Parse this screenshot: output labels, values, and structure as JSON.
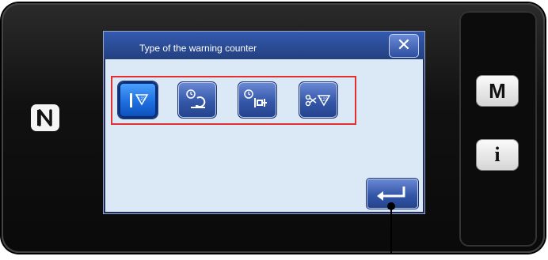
{
  "dialog": {
    "title": "Type of the warning counter",
    "close_icon": "close-icon",
    "counter_types": [
      {
        "icon": "bobbin-thread-counter-icon",
        "selected": true
      },
      {
        "icon": "operating-time-counter-icon",
        "selected": false
      },
      {
        "icon": "power-on-time-counter-icon",
        "selected": false
      },
      {
        "icon": "thread-trimming-counter-icon",
        "selected": false
      }
    ],
    "enter_icon": "enter-icon"
  },
  "side_panel": {
    "mode_label": "M",
    "info_label": "i",
    "nfc_icon": "nfc-icon"
  },
  "colors": {
    "title_bar": "#2b4a95",
    "dialog_body": "#dbe8f5",
    "selected_button": "#1f6fe0",
    "button": "#3557a8",
    "highlight_frame": "#e03030"
  }
}
